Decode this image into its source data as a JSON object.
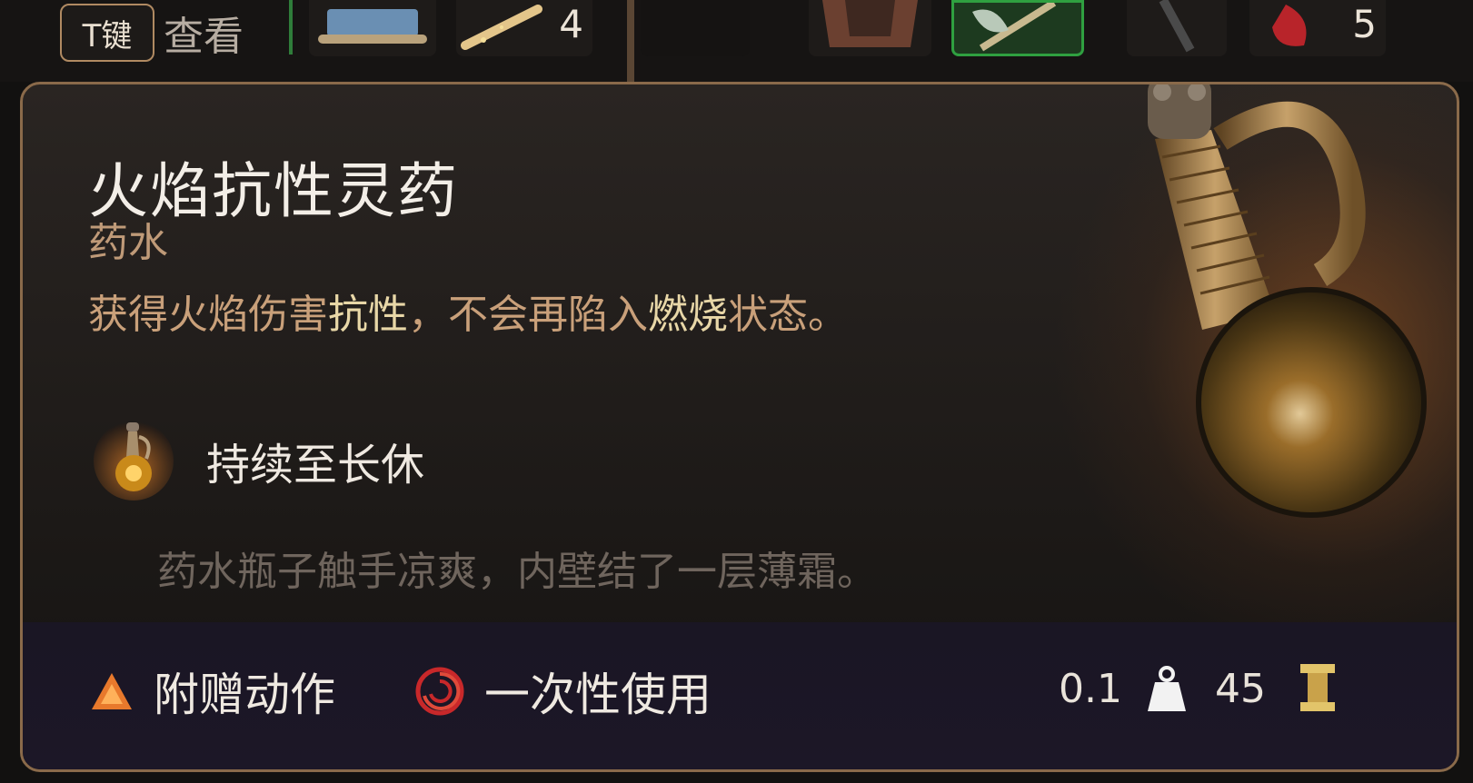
{
  "inventory_bar": {
    "inspect_key": "T键",
    "inspect_label": "查看",
    "slot_counts": [
      "4",
      "5"
    ]
  },
  "tooltip": {
    "title": "火焰抗性灵药",
    "type": "药水",
    "description": {
      "p1": "获得火焰伤害",
      "h1": "抗性",
      "p2": "，不会再陷入",
      "h2": "燃烧",
      "p3": "状态。"
    },
    "duration": "持续至长休",
    "flavor_text": "药水瓶子触手凉爽，内壁结了一层薄霜。",
    "footer": {
      "action_type": "附赠动作",
      "usage": "一次性使用",
      "weight": "0.1",
      "value": "45"
    }
  },
  "colors": {
    "border": "#8a6a4a",
    "title": "#f3eee7",
    "subtitle": "#bf9a78",
    "description": "#c9a07a",
    "highlight": "#e8d7a7",
    "flavor": "#6f655d",
    "footer_bg": "#1c1727",
    "action_triangle": "#e8792c",
    "usage_swirl": "#c8282a"
  },
  "icons": [
    "potion-flask-icon",
    "orange-triangle-icon",
    "red-swirl-icon",
    "weight-icon",
    "gold-coin-icon"
  ]
}
